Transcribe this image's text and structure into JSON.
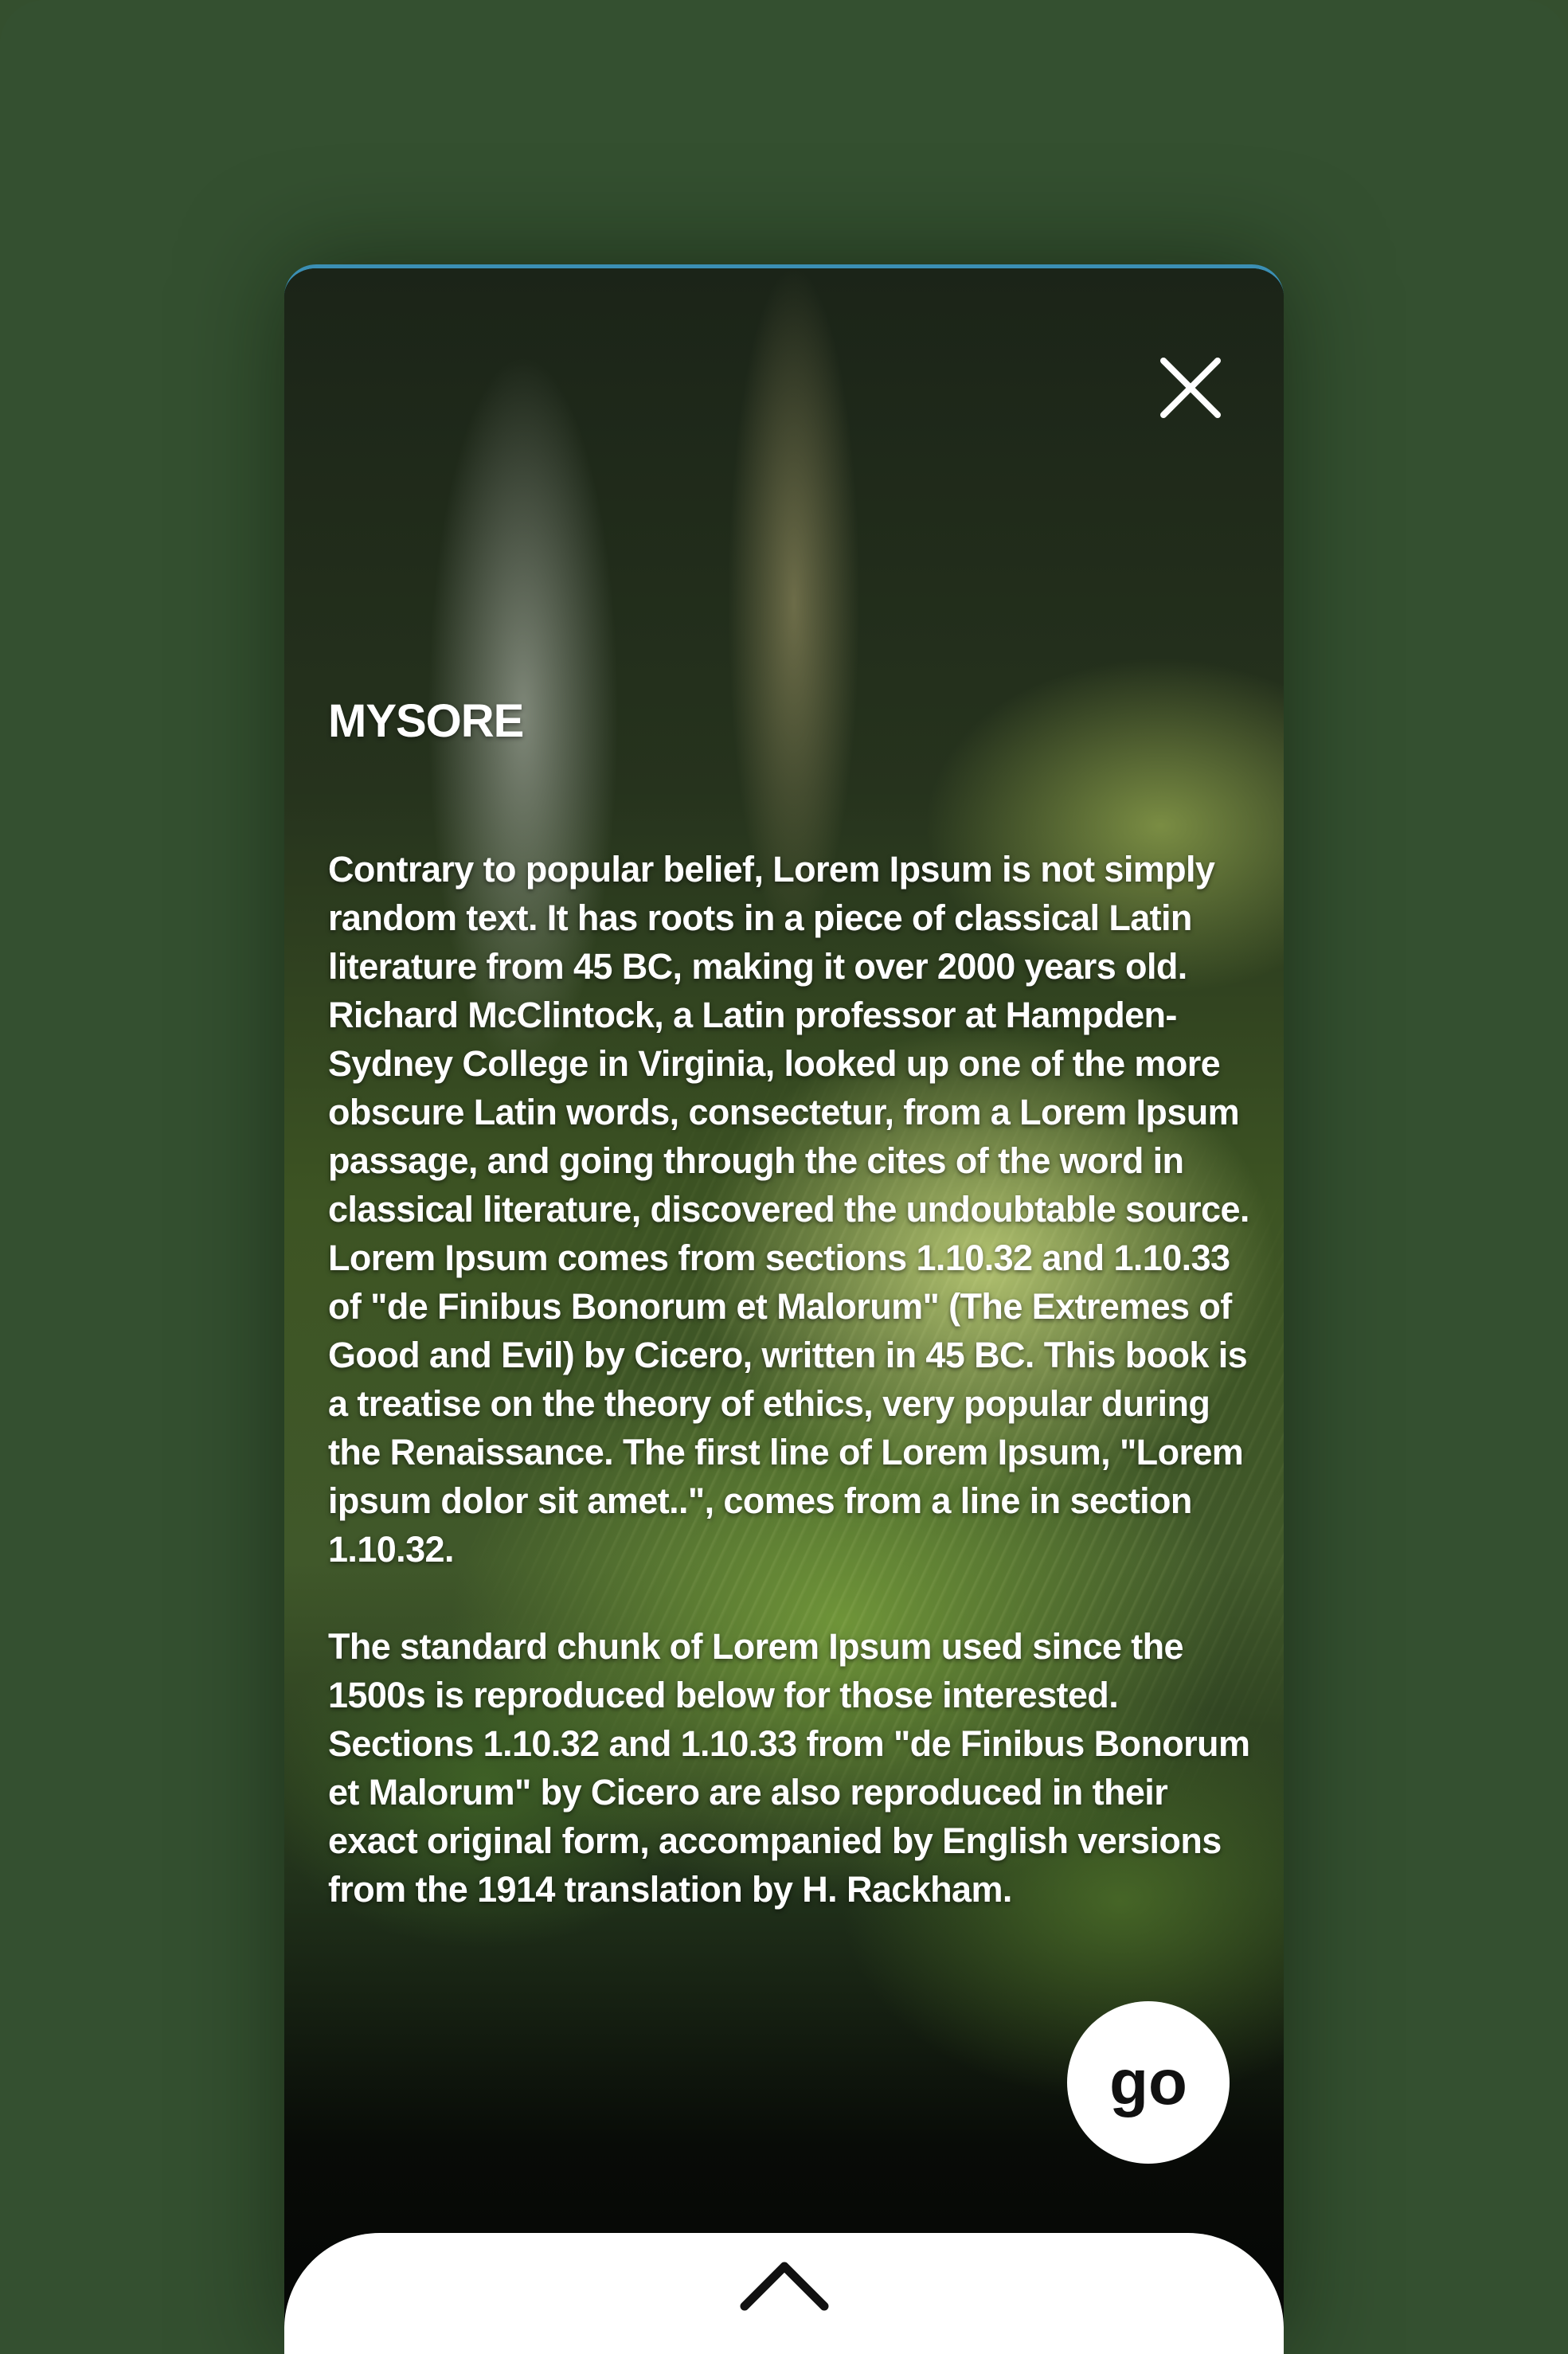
{
  "screen": {
    "background_color": "#345030",
    "card_accent_color": "#3b8fb4"
  },
  "header": {
    "close_icon": "close-icon"
  },
  "place": {
    "title": "MYSORE",
    "paragraphs": [
      "Contrary to popular belief, Lorem Ipsum is not simply random text. It has roots in a piece of classical Latin literature from 45 BC, making it over 2000 years old. Richard McClintock, a Latin professor at Hampden-Sydney College in Virginia, looked up one of the more obscure Latin words, consectetur, from a Lorem Ipsum passage, and going through the cites of the word in classical literature, discovered the undoubtable source. Lorem Ipsum comes from sections 1.10.32 and 1.10.33 of \"de Finibus Bonorum et Malorum\" (The Extremes of Good and Evil) by Cicero, written in 45 BC. This book is a treatise on the theory of ethics, very popular during the Renaissance. The first line of Lorem Ipsum, \"Lorem ipsum dolor sit amet..\", comes from a line in section 1.10.32.",
      "The standard chunk of Lorem Ipsum used since the 1500s is reproduced below for those interested. Sections 1.10.32 and 1.10.33 from \"de Finibus Bonorum et Malorum\" by Cicero are also reproduced in their exact original form, accompanied by English versions from the 1914 translation by H. Rackham."
    ]
  },
  "actions": {
    "go_label": "go"
  },
  "bottom_sheet": {
    "handle_icon": "chevron-up-icon"
  }
}
